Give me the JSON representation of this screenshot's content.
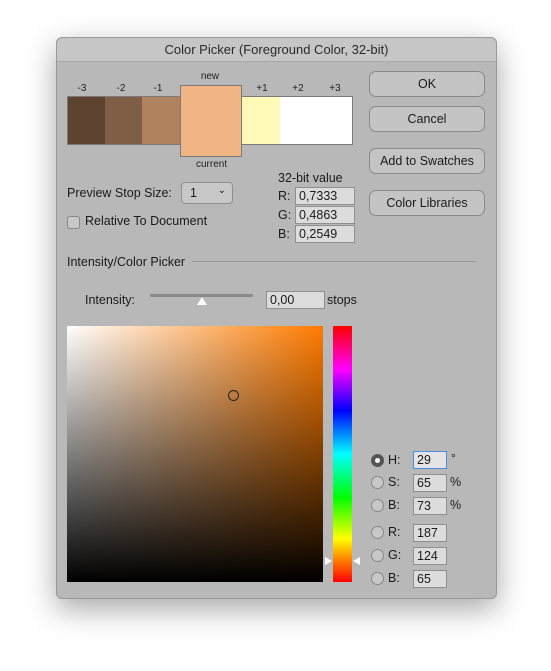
{
  "window": {
    "title": "Color Picker (Foreground Color, 32-bit)"
  },
  "preview": {
    "stops": [
      {
        "label": "-3",
        "color": "#5e4430"
      },
      {
        "label": "-2",
        "color": "#7f5e45"
      },
      {
        "label": "-1",
        "color": "#b0835e"
      },
      {
        "label": "+1",
        "color": "#fff9b7"
      },
      {
        "label": "+2",
        "color": "#ffffff"
      },
      {
        "label": "+3",
        "color": "#ffffff"
      }
    ],
    "new_label": "new",
    "current_label": "current",
    "new_color": "#f1b584"
  },
  "stop_size": {
    "label": "Preview Stop Size:",
    "value": "1"
  },
  "relative": {
    "label": "Relative To Document",
    "checked": false
  },
  "bit32": {
    "title": "32-bit value",
    "r_label": "R:",
    "r": "0,7333",
    "g_label": "G:",
    "g": "0,4863",
    "b_label": "B:",
    "b": "0,2549"
  },
  "buttons": {
    "ok": "OK",
    "cancel": "Cancel",
    "add": "Add to Swatches",
    "libraries": "Color Libraries"
  },
  "section": "Intensity/Color Picker",
  "intensity": {
    "label": "Intensity:",
    "value": "0,00",
    "unit": "stops",
    "slider_percent": 50
  },
  "picker": {
    "hue_deg": 29,
    "saturation": 65,
    "brightness": 73
  },
  "values": {
    "h_label": "H:",
    "h": "29",
    "h_unit": "°",
    "s_label": "S:",
    "s": "65",
    "s_unit": "%",
    "bb_label": "B:",
    "bb": "73",
    "bb_unit": "%",
    "r_label": "R:",
    "r": "187",
    "g_label": "G:",
    "g": "124",
    "b_label": "B:",
    "b": "65",
    "selected": "H"
  }
}
